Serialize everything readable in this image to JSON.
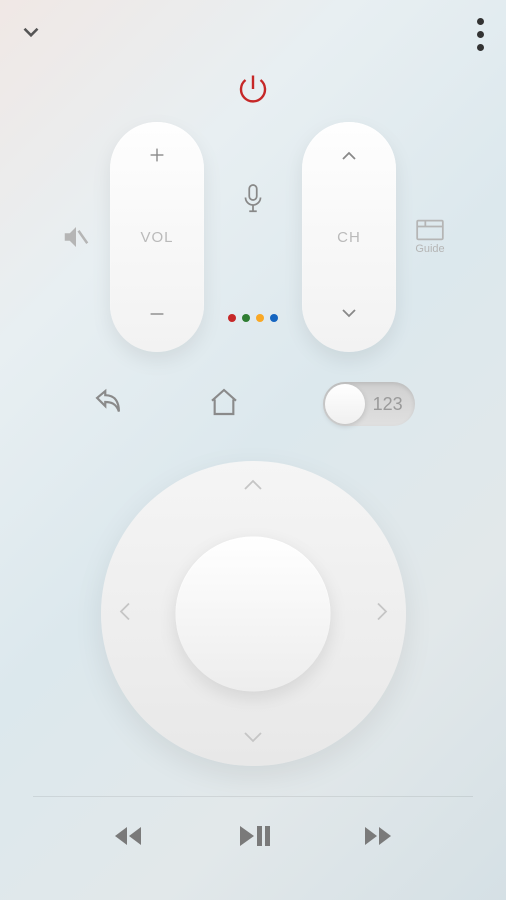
{
  "header": {
    "collapse_icon": "chevron-down",
    "menu_icon": "vertical-dots"
  },
  "power": {
    "icon": "power",
    "color": "#c62828"
  },
  "volume": {
    "label": "VOL",
    "up_icon": "plus",
    "down_icon": "minus"
  },
  "channel": {
    "label": "CH",
    "up_icon": "chevron-up",
    "down_icon": "chevron-down"
  },
  "mute": {
    "icon": "volume-mute"
  },
  "guide": {
    "icon": "guide",
    "label": "Guide"
  },
  "mic": {
    "icon": "microphone"
  },
  "color_buttons": [
    "#c62828",
    "#2e7d32",
    "#f9a825",
    "#1565c0"
  ],
  "back": {
    "icon": "undo-arrow"
  },
  "home": {
    "icon": "home"
  },
  "numpad_toggle": {
    "label": "123",
    "state": "off"
  },
  "dpad": {
    "up": "chevron-up",
    "down": "chevron-down",
    "left": "chevron-left",
    "right": "chevron-right"
  },
  "media": {
    "rewind": "rewind",
    "playpause": "play-pause",
    "forward": "fast-forward"
  }
}
